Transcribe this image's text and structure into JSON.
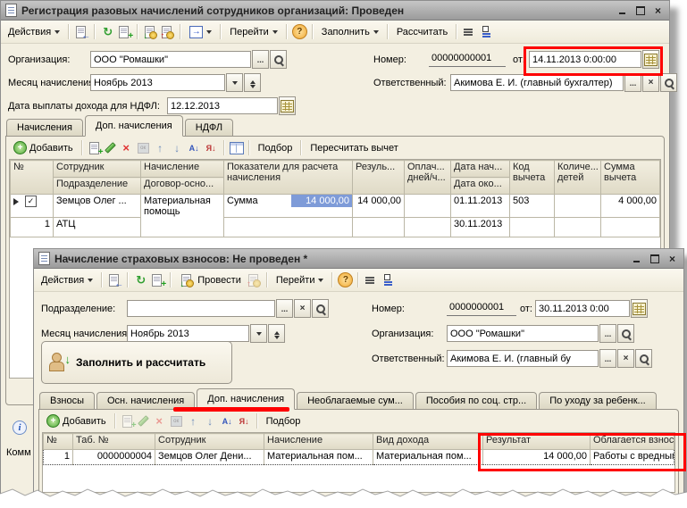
{
  "ic": {
    "close": "×",
    "help": "?",
    "ellipsis": "...",
    "clear": "×",
    "check": "✓",
    "info": "i"
  },
  "w1": {
    "title": "Регистрация разовых начислений сотрудников организаций: Проведен",
    "toolbar": {
      "actions": "Действия",
      "go": "Перейти",
      "fill": "Заполнить",
      "calculate": "Рассчитать"
    },
    "form": {
      "org_label": "Организация:",
      "org_value": "ООО \"Ромашки\"",
      "number_label": "Номер:",
      "number_value": "00000000001",
      "from_label": "от:",
      "date_value": "14.11.2013  0:00:00",
      "month_label": "Месяц начисления:",
      "month_value": "Ноябрь 2013",
      "resp_label": "Ответственный:",
      "resp_value": "Акимова Е. И. (главный бухгалтер)",
      "payout_label": "Дата выплаты дохода для НДФЛ:",
      "payout_value": "12.12.2013"
    },
    "tabs": [
      {
        "label": "Начисления"
      },
      {
        "label": "Доп. начисления"
      },
      {
        "label": "НДФЛ"
      }
    ],
    "grid_toolbar": {
      "add": "Добавить",
      "pick": "Подбор",
      "recalc": "Пересчитать вычет",
      "sort_az": "А↓",
      "sort_za": "Я↓"
    },
    "grid": {
      "h_num": "№",
      "h_emp": "Сотрудник",
      "h_dep": "Подразделение",
      "h_acc": "Начисление",
      "h_contract": "Договор-осно...",
      "h_ind": "Показатели для расчета начисления",
      "h_res": "Резуль...",
      "h_paid": "Оплач... дней/ч...",
      "h_ds": "Дата нач...",
      "h_de": "Дата око...",
      "h_code": "Код вычета",
      "h_child": "Количе... детей",
      "h_ded": "Сумма вычета",
      "r_emp": "Земцов Олег ...",
      "r_line": "1",
      "r_dep": "АТЦ",
      "r_acc": "Материальная помощь",
      "r_ind_name": "Сумма",
      "r_ind_val": "14 000,00",
      "r_res": "14 000,00",
      "r_ds": "01.11.2013",
      "r_de": "30.11.2013",
      "r_code": "503",
      "r_ded": "4 000,00"
    },
    "comment_label": "Комм"
  },
  "w2": {
    "title": "Начисление страховых взносов: Не проведен *",
    "toolbar": {
      "actions": "Действия",
      "post": "Провести",
      "go": "Перейти"
    },
    "form": {
      "dep_label": "Подразделение:",
      "dep_value": "",
      "number_label": "Номер:",
      "number_value": "0000000001",
      "from_label": "от:",
      "date_value": "30.11.2013  0:00",
      "month_label": "Месяц начисления:",
      "month_value": "Ноябрь 2013",
      "org_label": "Организация:",
      "org_value": "ООО \"Ромашки\"",
      "resp_label": "Ответственный:",
      "resp_value": "Акимова Е. И. (главный бу",
      "fill_button": "Заполнить и рассчитать"
    },
    "tabs": [
      {
        "label": "Взносы"
      },
      {
        "label": "Осн. начисления"
      },
      {
        "label": "Доп. начисления"
      },
      {
        "label": "Необлагаемые сум..."
      },
      {
        "label": "Пособия по соц. стр..."
      },
      {
        "label": "По уходу за ребенк..."
      }
    ],
    "grid_toolbar": {
      "add": "Добавить",
      "pick": "Подбор",
      "sort_az": "А↓",
      "sort_za": "Я↓"
    },
    "grid": {
      "headers": [
        "№",
        "Таб. №",
        "Сотрудник",
        "Начисление",
        "Вид дохода",
        "Результат",
        "Облагается взноса..."
      ],
      "row": [
        "1",
        "0000000004",
        "Земцов Олег Дени...",
        "Материальная пом...",
        "Материальная пом...",
        "14 000,00",
        "Работы с вредным..."
      ]
    }
  },
  "annotation_color": "#FE0000"
}
